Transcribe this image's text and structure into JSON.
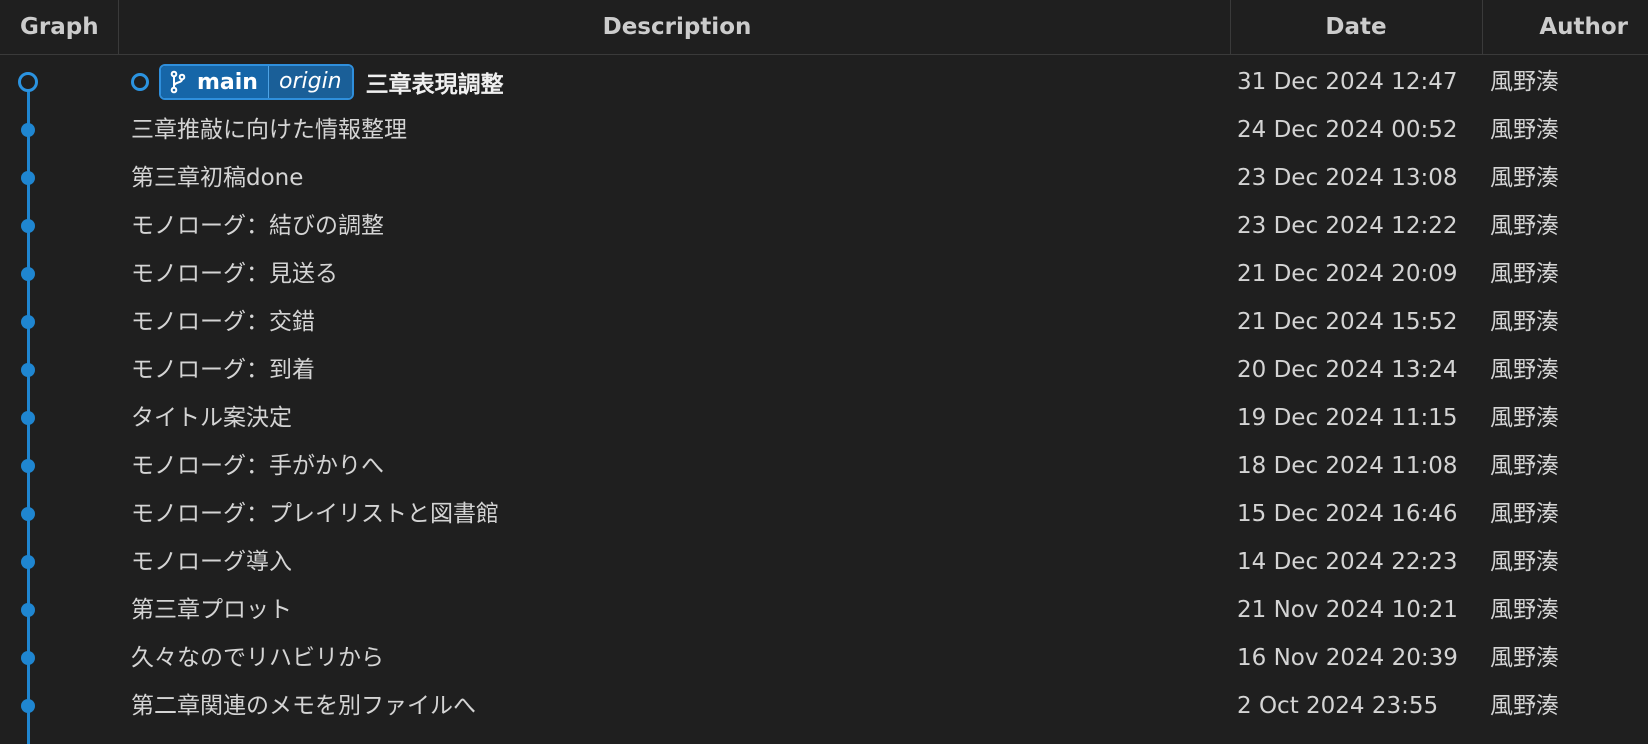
{
  "header": {
    "graph": "Graph",
    "description": "Description",
    "date": "Date",
    "author": "Author"
  },
  "head": {
    "branch": "main",
    "remote": "origin",
    "description": "三章表現調整",
    "date": "31 Dec 2024 12:47",
    "author": "風野湊"
  },
  "commits": [
    {
      "description": "三章推敲に向けた情報整理",
      "date": "24 Dec 2024 00:52",
      "author": "風野湊"
    },
    {
      "description": "第三章初稿done",
      "date": "23 Dec 2024 13:08",
      "author": "風野湊"
    },
    {
      "description": "モノローグ：結びの調整",
      "date": "23 Dec 2024 12:22",
      "author": "風野湊"
    },
    {
      "description": "モノローグ：見送る",
      "date": "21 Dec 2024 20:09",
      "author": "風野湊"
    },
    {
      "description": "モノローグ：交錯",
      "date": "21 Dec 2024 15:52",
      "author": "風野湊"
    },
    {
      "description": "モノローグ：到着",
      "date": "20 Dec 2024 13:24",
      "author": "風野湊"
    },
    {
      "description": "タイトル案決定",
      "date": "19 Dec 2024 11:15",
      "author": "風野湊"
    },
    {
      "description": "モノローグ：手がかりへ",
      "date": "18 Dec 2024 11:08",
      "author": "風野湊"
    },
    {
      "description": "モノローグ：プレイリストと図書館",
      "date": "15 Dec 2024 16:46",
      "author": "風野湊"
    },
    {
      "description": "モノローグ導入",
      "date": "14 Dec 2024 22:23",
      "author": "風野湊"
    },
    {
      "description": "第三章プロット",
      "date": "21 Nov 2024 10:21",
      "author": "風野湊"
    },
    {
      "description": "久々なのでリハビリから",
      "date": "16 Nov 2024 20:39",
      "author": "風野湊"
    },
    {
      "description": "第二章関連のメモを別ファイルへ",
      "date": "2 Oct 2024 23:55",
      "author": "風野湊"
    }
  ],
  "colors": {
    "background": "#1f1f1f",
    "graph_line": "#1f86d1",
    "badge": "#1666a8",
    "text": "#d4d4d4"
  },
  "icons": {
    "branch": "git-branch-icon"
  }
}
